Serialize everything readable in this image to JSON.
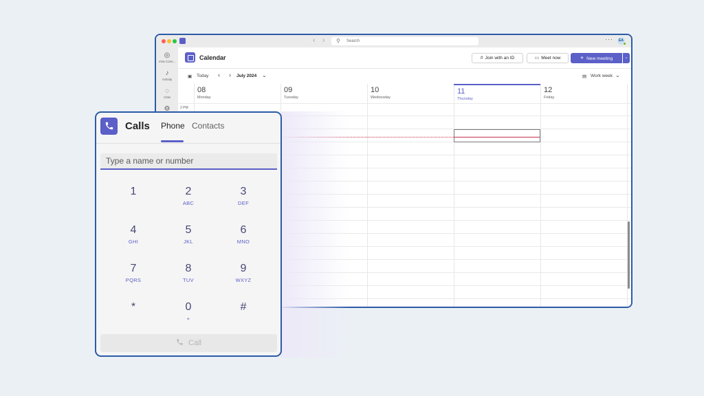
{
  "teams": {
    "search_placeholder": "Search",
    "more_label": "···",
    "avatar_initials": "EA",
    "rail": [
      {
        "label": "Viva Conn...",
        "icon": "viva-connections-icon"
      },
      {
        "label": "Activity",
        "icon": "bell-icon"
      },
      {
        "label": "Chat",
        "icon": "chat-icon"
      },
      {
        "label": "",
        "icon": "teams-icon"
      }
    ],
    "calendar": {
      "title": "Calendar",
      "join_label": "Join with an ID",
      "meet_label": "Meet now",
      "new_meeting_label": "New meeting",
      "today_label": "Today",
      "month_label": "July 2024",
      "view_label": "Work week",
      "time_label": "2 PM",
      "days": [
        {
          "num": "08",
          "name": "Monday"
        },
        {
          "num": "09",
          "name": "Tuesday"
        },
        {
          "num": "10",
          "name": "Wednesday"
        },
        {
          "num": "11",
          "name": "Thursday"
        },
        {
          "num": "12",
          "name": "Friday"
        }
      ],
      "today_index": 3
    }
  },
  "calls": {
    "title": "Calls",
    "tabs": [
      "Phone",
      "Contacts"
    ],
    "active_tab": "Phone",
    "input_placeholder": "Type a name or number",
    "keys": [
      {
        "digit": "1",
        "letters": ""
      },
      {
        "digit": "2",
        "letters": "ABC"
      },
      {
        "digit": "3",
        "letters": "DEF"
      },
      {
        "digit": "4",
        "letters": "GHI"
      },
      {
        "digit": "5",
        "letters": "JKL"
      },
      {
        "digit": "6",
        "letters": "MNO"
      },
      {
        "digit": "7",
        "letters": "PQRS"
      },
      {
        "digit": "8",
        "letters": "TUV"
      },
      {
        "digit": "9",
        "letters": "WXYZ"
      },
      {
        "digit": "*",
        "letters": ""
      },
      {
        "digit": "0",
        "letters": "+"
      },
      {
        "digit": "#",
        "letters": ""
      }
    ],
    "call_label": "Call"
  },
  "colors": {
    "brand": "#5b5fc7",
    "frame": "#2b5ba6",
    "now_line": "#c4314b"
  }
}
